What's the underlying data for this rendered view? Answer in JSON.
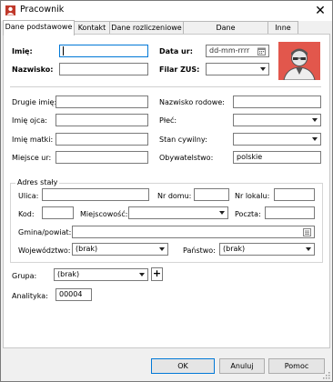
{
  "window": {
    "title": "Pracownik",
    "close_label": "✕"
  },
  "tabs": [
    {
      "label": "Dane podstawowe"
    },
    {
      "label": "Kontakt"
    },
    {
      "label": "Dane rozliczeniowe"
    },
    {
      "label": "Dane ubezpieczeniowe"
    },
    {
      "label": "Inne"
    }
  ],
  "top": {
    "imie_label": "Imię:",
    "imie_value": "",
    "nazwisko_label": "Nazwisko:",
    "nazwisko_value": "",
    "data_ur_label": "Data ur:",
    "data_ur_placeholder": "dd-mm-rrrr",
    "filar_label": "Filar ZUS:",
    "filar_value": ""
  },
  "personal": {
    "drugie_imie_label": "Drugie imię:",
    "imie_ojca_label": "Imię ojca:",
    "imie_matki_label": "Imię matki:",
    "miejsce_ur_label": "Miejsce ur:",
    "nazwisko_rodowe_label": "Nazwisko rodowe:",
    "plec_label": "Płeć:",
    "stan_cywilny_label": "Stan cywilny:",
    "obywatelstwo_label": "Obywatelstwo:",
    "obywatelstwo_value": "polskie"
  },
  "address": {
    "legend": "Adres stały",
    "ulica_label": "Ulica:",
    "nr_domu_label": "Nr domu:",
    "nr_lokalu_label": "Nr lokalu:",
    "kod_label": "Kod:",
    "miejscowosc_label": "Miejscowość:",
    "poczta_label": "Poczta:",
    "gmina_label": "Gmina/powiat:",
    "wojewodztwo_label": "Województwo:",
    "wojewodztwo_value": "(brak)",
    "panstwo_label": "Państwo:",
    "panstwo_value": "(brak)"
  },
  "extra": {
    "grupa_label": "Grupa:",
    "grupa_value": "(brak)",
    "add_label": "+",
    "analityka_label": "Analityka:",
    "analityka_value": "00004"
  },
  "buttons": {
    "ok": "OK",
    "cancel": "Anuluj",
    "help": "Pomoc"
  },
  "colors": {
    "avatar_bg": "#e2574c",
    "focus_border": "#0078d7"
  }
}
